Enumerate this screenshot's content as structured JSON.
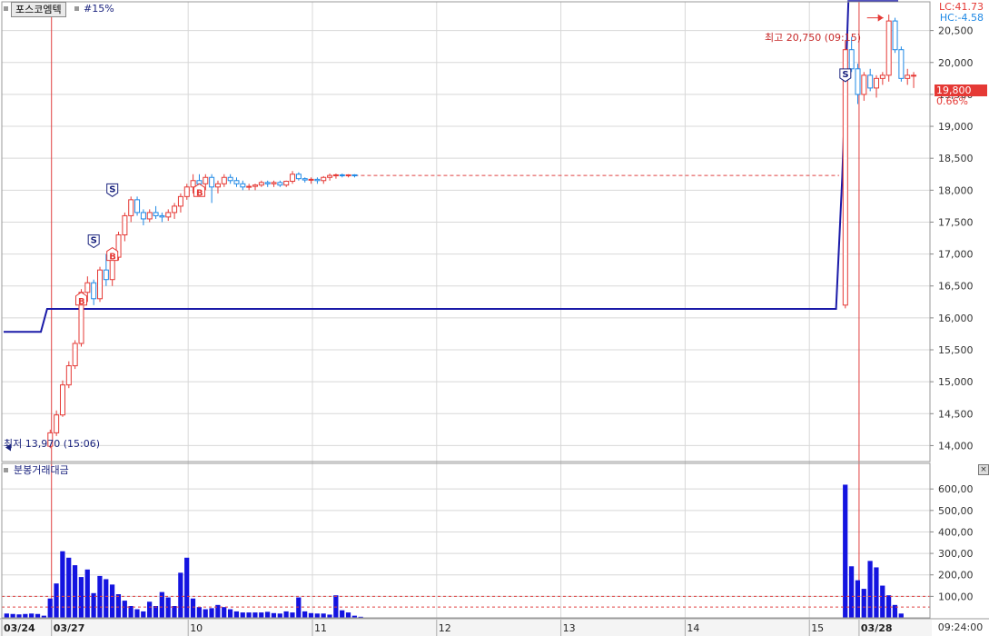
{
  "header": {
    "stock_name": "포스코엠텍",
    "period": "#15%",
    "lc": "LC:41.73",
    "hc": "HC:-4.58"
  },
  "current": {
    "price": "19,800",
    "pct": "0.66%"
  },
  "annotations": {
    "high": "최고 20,750 (09:15)",
    "low": "최저 13,970 (15:06)"
  },
  "volume_panel": {
    "title": "분봉거래대금",
    "close_label": "×"
  },
  "time_readout": "09:24:00",
  "colors": {
    "up": "#e53935",
    "down": "#1e88e5",
    "line": "#1a1aa8",
    "volume": "#1414e0",
    "grid": "#d8d8d8",
    "session": "#e04040"
  },
  "chart_data": [
    {
      "type": "candlestick",
      "title": "",
      "y_ticks": [
        "14,000",
        "14,500",
        "15,000",
        "15,500",
        "16,000",
        "16,500",
        "17,000",
        "17,500",
        "18,000",
        "18,500",
        "19,000",
        "19,500",
        "20,000",
        "20,500"
      ],
      "y_tick_values": [
        14000,
        14500,
        15000,
        15500,
        16000,
        16500,
        17000,
        17500,
        18000,
        18500,
        19000,
        19500,
        20000,
        20500
      ],
      "ylim": [
        13750,
        20950
      ],
      "x_labels": [
        "03/24",
        "03/27",
        "10",
        "11",
        "12",
        "13",
        "14",
        "15",
        "03/28"
      ],
      "x_label_bars": [
        0,
        8,
        30,
        50,
        70,
        90,
        110,
        130,
        138
      ],
      "bar_count": 165,
      "ohlc": [
        [
          13990,
          14250,
          13960,
          14200
        ],
        [
          14200,
          14550,
          14150,
          14480
        ],
        [
          14480,
          15020,
          14450,
          14950
        ],
        [
          14950,
          15320,
          14900,
          15250
        ],
        [
          15250,
          15650,
          15200,
          15600
        ],
        [
          15600,
          16450,
          15550,
          16400
        ],
        [
          16400,
          16650,
          16250,
          16550
        ],
        [
          16550,
          16600,
          16200,
          16300
        ],
        [
          16300,
          16800,
          16250,
          16750
        ],
        [
          16750,
          17000,
          16500,
          16600
        ],
        [
          16600,
          17050,
          16500,
          16950
        ],
        [
          16950,
          17350,
          16900,
          17300
        ],
        [
          17300,
          17650,
          17200,
          17600
        ],
        [
          17600,
          17900,
          17500,
          17850
        ],
        [
          17850,
          17900,
          17600,
          17650
        ],
        [
          17650,
          17700,
          17450,
          17550
        ],
        [
          17550,
          17700,
          17500,
          17650
        ],
        [
          17650,
          17750,
          17550,
          17600
        ],
        [
          17600,
          17650,
          17500,
          17580
        ],
        [
          17580,
          17700,
          17520,
          17650
        ],
        [
          17650,
          17800,
          17550,
          17750
        ],
        [
          17750,
          17950,
          17650,
          17900
        ],
        [
          17900,
          18100,
          17850,
          18050
        ],
        [
          18050,
          18250,
          17950,
          18150
        ],
        [
          18150,
          18250,
          18050,
          18100
        ],
        [
          18100,
          18250,
          18000,
          18200
        ],
        [
          18200,
          18250,
          17800,
          18050
        ],
        [
          18050,
          18150,
          17950,
          18100
        ],
        [
          18100,
          18250,
          18050,
          18200
        ],
        [
          18200,
          18250,
          18100,
          18150
        ],
        [
          18150,
          18200,
          18050,
          18100
        ],
        [
          18100,
          18150,
          18000,
          18050
        ],
        [
          18050,
          18100,
          18000,
          18060
        ],
        [
          18060,
          18100,
          18000,
          18080
        ],
        [
          18080,
          18150,
          18050,
          18120
        ],
        [
          18120,
          18150,
          18050,
          18100
        ],
        [
          18100,
          18150,
          18050,
          18120
        ],
        [
          18120,
          18150,
          18050,
          18080
        ],
        [
          18080,
          18150,
          18050,
          18140
        ],
        [
          18140,
          18300,
          18100,
          18250
        ],
        [
          18250,
          18280,
          18150,
          18180
        ],
        [
          18180,
          18200,
          18120,
          18160
        ],
        [
          18160,
          18200,
          18100,
          18170
        ],
        [
          18170,
          18200,
          18100,
          18150
        ],
        [
          18150,
          18220,
          18100,
          18200
        ],
        [
          18200,
          18260,
          18150,
          18230
        ],
        [
          18230,
          18260,
          18180,
          18240
        ],
        [
          18240,
          18260,
          18200,
          18230
        ],
        [
          18230,
          18250,
          18200,
          18240
        ],
        [
          18240,
          18250,
          18200,
          18230
        ],
        [
          16200,
          20350,
          16150,
          20200
        ],
        [
          20200,
          20400,
          19850,
          19900
        ],
        [
          19900,
          19980,
          19350,
          19500
        ],
        [
          19500,
          19850,
          19400,
          19800
        ],
        [
          19800,
          19900,
          19550,
          19600
        ],
        [
          19600,
          19800,
          19450,
          19750
        ],
        [
          19750,
          19850,
          19650,
          19800
        ],
        [
          19800,
          20750,
          19700,
          20650
        ],
        [
          20650,
          20700,
          20150,
          20200
        ],
        [
          20200,
          20250,
          19700,
          19750
        ],
        [
          19750,
          19900,
          19650,
          19800
        ],
        [
          19800,
          19850,
          19600,
          19800
        ]
      ],
      "ohlc_bars": [
        7,
        8,
        9,
        10,
        11,
        12,
        13,
        14,
        15,
        16,
        17,
        18,
        19,
        20,
        21,
        22,
        23,
        24,
        25,
        26,
        27,
        28,
        29,
        30,
        31,
        32,
        33,
        34,
        35,
        36,
        37,
        38,
        39,
        40,
        41,
        42,
        43,
        44,
        45,
        46,
        47,
        48,
        49,
        50,
        51,
        52,
        53,
        54,
        55,
        56,
        135,
        136,
        137,
        138,
        139,
        140,
        141,
        142,
        143,
        144,
        145,
        146
      ],
      "signals": [
        {
          "bar": 17,
          "type": "S",
          "price": 17900
        },
        {
          "bar": 14,
          "type": "S",
          "price": 17100
        },
        {
          "bar": 12,
          "type": "B",
          "price": 16400
        },
        {
          "bar": 17,
          "type": "B",
          "price": 17100
        },
        {
          "bar": 31,
          "type": "B",
          "price": 18100
        },
        {
          "bar": 135,
          "type": "S",
          "price": 19700
        }
      ],
      "ref_line": 18230,
      "high_marker": {
        "bar": 142,
        "price": 20700
      },
      "low_marker": {
        "bar": 7,
        "price": 13970
      },
      "step_line": [
        {
          "bar": 0,
          "value": 15780
        },
        {
          "bar": 6,
          "value": 15780
        },
        {
          "bar": 7,
          "value": 16140
        },
        {
          "bar": 134,
          "value": 16140
        },
        {
          "bar": 135,
          "value": 18200
        },
        {
          "bar": 136,
          "value": 20960
        },
        {
          "bar": 144,
          "value": 20960
        }
      ]
    },
    {
      "type": "bar",
      "title": "분봉거래대금",
      "y_ticks": [
        "100,00",
        "200,00",
        "300,00",
        "400,00",
        "500,00",
        "600,00"
      ],
      "y_tick_values": [
        100,
        200,
        300,
        400,
        500,
        600
      ],
      "ylim": [
        0,
        660
      ],
      "ref_lines": [
        100,
        50
      ],
      "bars": [
        0,
        1,
        2,
        3,
        4,
        5,
        6,
        7,
        8,
        9,
        10,
        11,
        12,
        13,
        14,
        15,
        16,
        17,
        18,
        19,
        20,
        21,
        22,
        23,
        24,
        25,
        26,
        27,
        28,
        29,
        30,
        31,
        32,
        33,
        34,
        35,
        36,
        37,
        38,
        39,
        40,
        41,
        42,
        43,
        44,
        45,
        46,
        47,
        48,
        49,
        50,
        51,
        52,
        53,
        54,
        55,
        56,
        57,
        135,
        136,
        137,
        138,
        139,
        140,
        141,
        142,
        143,
        144
      ],
      "values": [
        20,
        18,
        16,
        18,
        20,
        18,
        10,
        90,
        160,
        310,
        280,
        245,
        190,
        225,
        115,
        195,
        180,
        155,
        110,
        80,
        55,
        40,
        30,
        75,
        55,
        120,
        95,
        55,
        210,
        280,
        90,
        50,
        40,
        45,
        60,
        50,
        40,
        30,
        25,
        25,
        25,
        25,
        28,
        22,
        20,
        30,
        25,
        95,
        30,
        22,
        20,
        20,
        15,
        105,
        35,
        25,
        10,
        5,
        620,
        240,
        175,
        135,
        265,
        235,
        150,
        105,
        60,
        20
      ]
    }
  ]
}
